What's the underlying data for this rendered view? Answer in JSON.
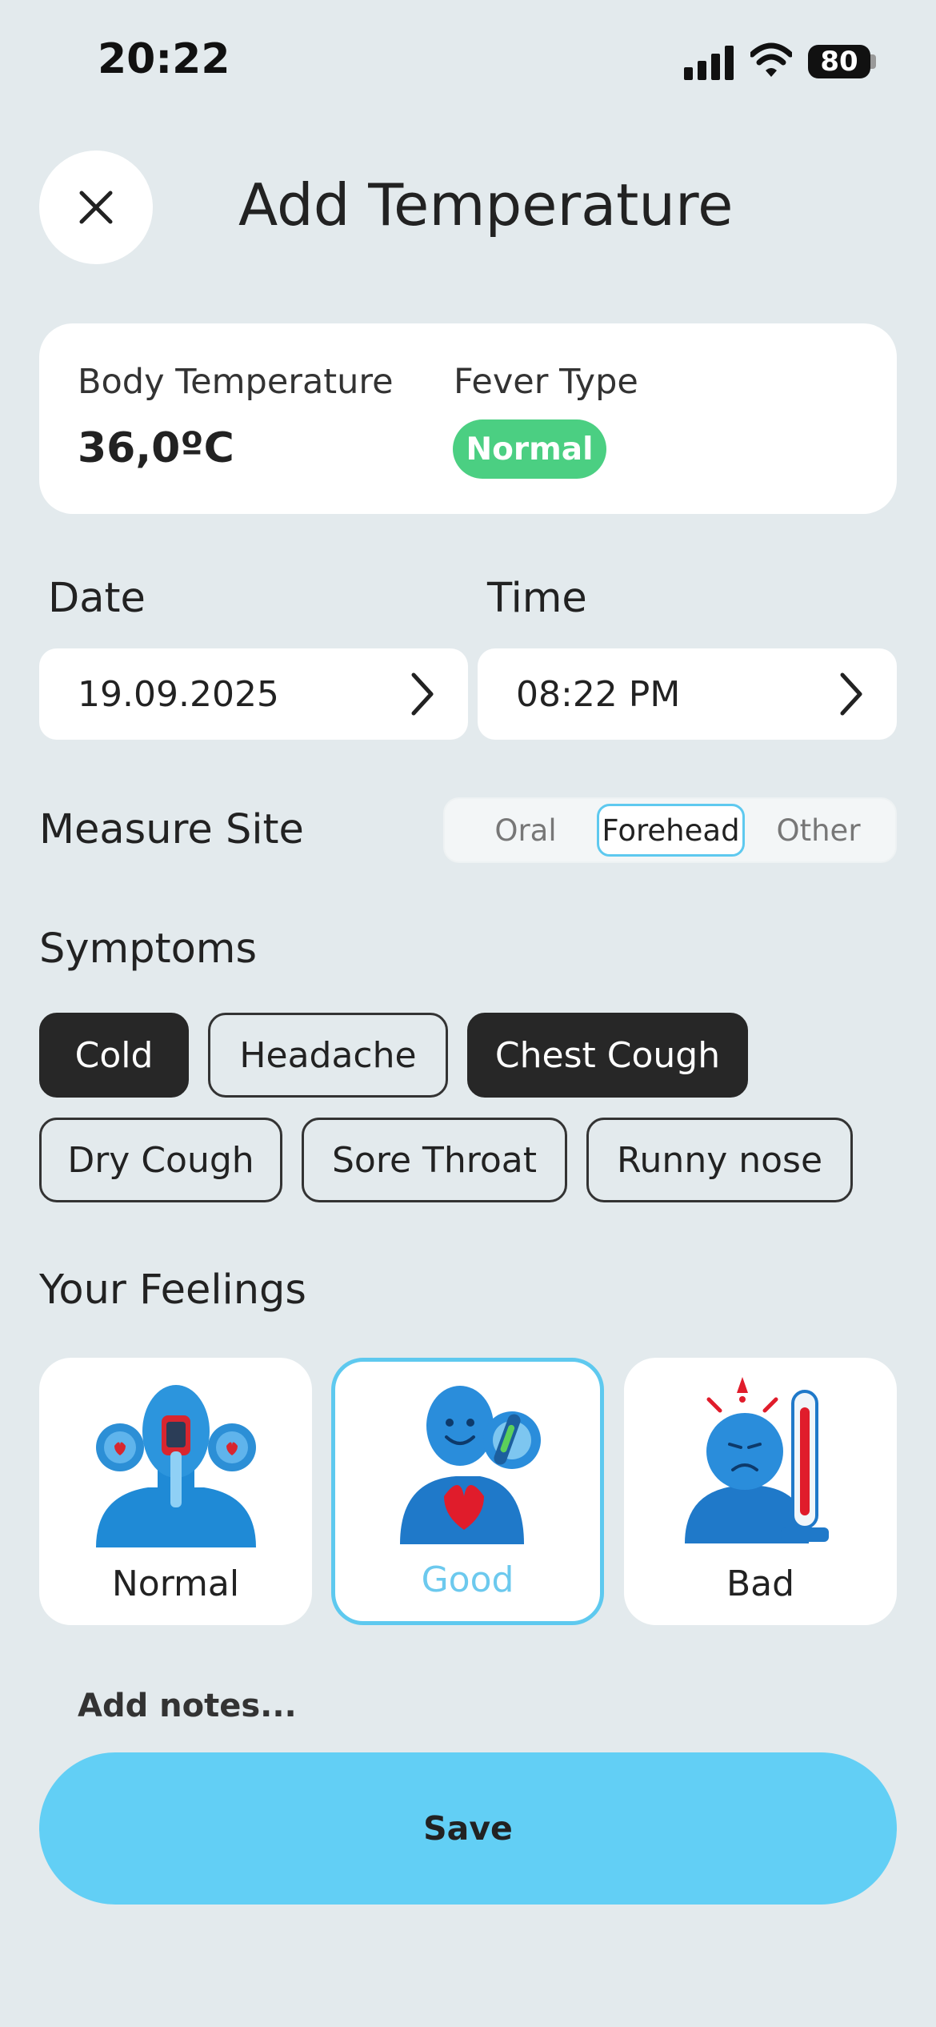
{
  "status_bar": {
    "time": "20:22",
    "battery": "80"
  },
  "header": {
    "title": "Add Temperature",
    "close_icon": "close-icon"
  },
  "summary": {
    "body_temp_label": "Body Temperature",
    "body_temp_value": "36,0ºC",
    "fever_label": "Fever Type",
    "fever_value": "Normal",
    "fever_color": "#4bcf82"
  },
  "date": {
    "label": "Date",
    "value": "19.09.2025"
  },
  "time": {
    "label": "Time",
    "value": "08:22 PM"
  },
  "measure_site": {
    "label": "Measure Site",
    "options": [
      "Oral",
      "Forehead",
      "Other"
    ],
    "selected": "Forehead"
  },
  "symptoms": {
    "label": "Symptoms",
    "chips": [
      {
        "label": "Cold",
        "selected": true
      },
      {
        "label": "Headache",
        "selected": false
      },
      {
        "label": "Chest Cough",
        "selected": true
      },
      {
        "label": "Dry Cough",
        "selected": false
      },
      {
        "label": "Sore Throat",
        "selected": false
      },
      {
        "label": "Runny nose",
        "selected": false
      }
    ]
  },
  "feelings": {
    "label": "Your Feelings",
    "options": [
      {
        "label": "Normal",
        "icon": "thermometer-person-icon"
      },
      {
        "label": "Good",
        "icon": "happy-person-icon"
      },
      {
        "label": "Bad",
        "icon": "sick-person-icon"
      }
    ],
    "selected": "Good"
  },
  "notes": {
    "placeholder": "Add notes..."
  },
  "save_label": "Save",
  "colors": {
    "accent": "#62cff5",
    "selected_border": "#5ec9ef",
    "chip_selected": "#272727",
    "background": "#e3eaed"
  }
}
